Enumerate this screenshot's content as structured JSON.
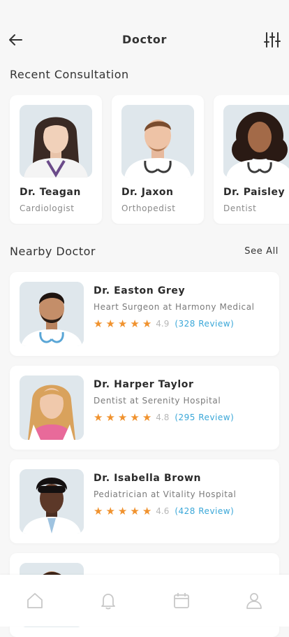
{
  "header": {
    "title": "Doctor"
  },
  "recent": {
    "title": "Recent Consultation",
    "items": [
      {
        "name": "Dr. Teagan",
        "specialty": "Cardiologist"
      },
      {
        "name": "Dr. Jaxon",
        "specialty": "Orthopedist"
      },
      {
        "name": "Dr. Paisley",
        "specialty": "Dentist"
      }
    ]
  },
  "nearby": {
    "title": "Nearby Doctor",
    "see_all": "See All",
    "items": [
      {
        "name": "Dr. Easton Grey",
        "subtitle": "Heart Surgeon at Harmony Medical",
        "rating": "4.9",
        "stars": 5,
        "reviews": "(328 Review)"
      },
      {
        "name": "Dr. Harper Taylor",
        "subtitle": "Dentist at Serenity Hospital",
        "rating": "4.8",
        "stars": 5,
        "reviews": "(295 Review)"
      },
      {
        "name": "Dr. Isabella Brown",
        "subtitle": "Pediatrician at Vitality Hospital",
        "rating": "4.6",
        "stars": 5,
        "reviews": "(428 Review)"
      }
    ]
  },
  "icons": {
    "back": "arrow-left-icon",
    "filter": "sliders-icon",
    "tabs": [
      "home-icon",
      "bell-icon",
      "calendar-icon",
      "user-icon"
    ]
  },
  "colors": {
    "accent": "#3aa7d8",
    "star": "#f0922e",
    "photo_bg": "#dfe7ec"
  }
}
